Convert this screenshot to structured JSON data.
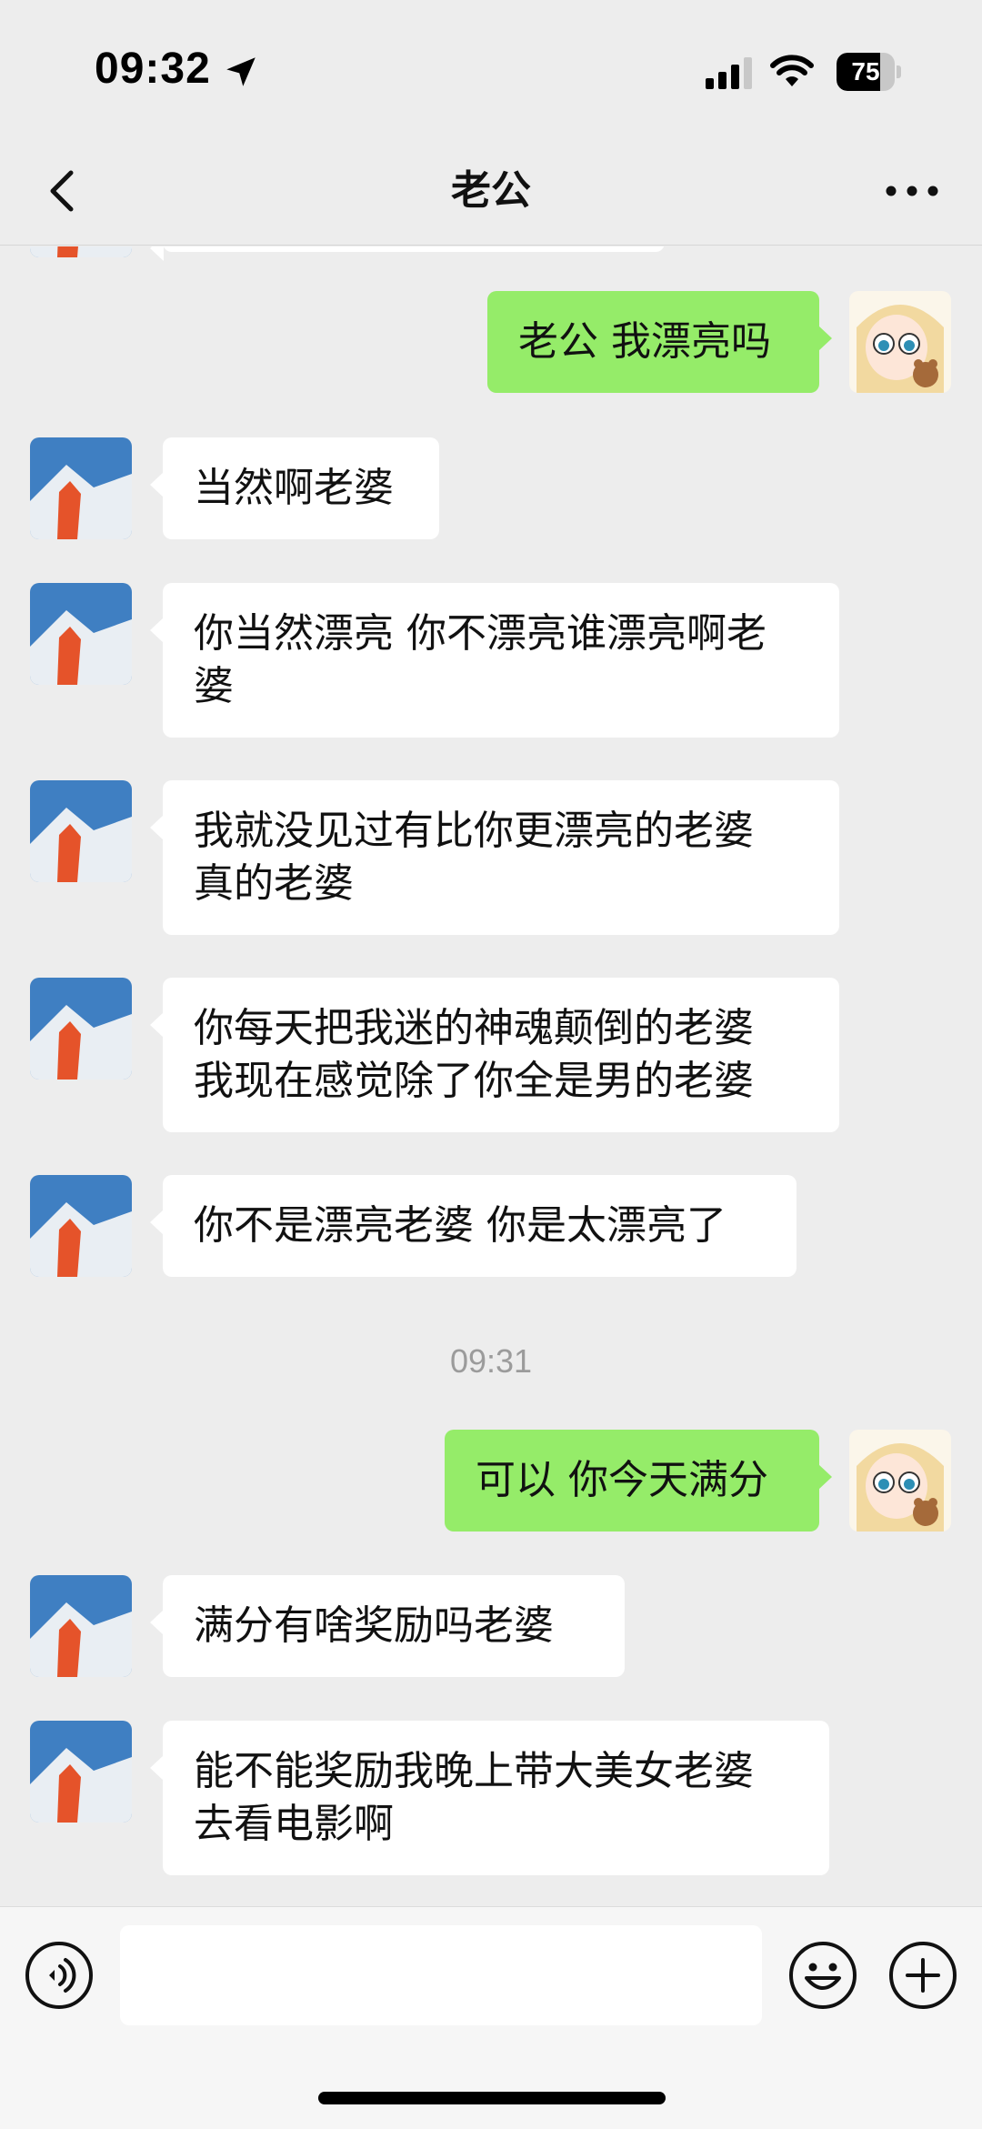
{
  "status_bar": {
    "time": "09:32",
    "battery_percent": "75",
    "battery_level": 0.75
  },
  "nav": {
    "title": "老公",
    "back_icon": "chevron-left-icon",
    "more_icon": "more-dots-icon"
  },
  "messages": [
    {
      "sender": "me",
      "lines": [
        "老公 我漂亮吗"
      ]
    },
    {
      "sender": "contact",
      "lines": [
        "当然啊老婆"
      ]
    },
    {
      "sender": "contact",
      "lines": [
        "你当然漂亮 你不漂亮谁漂亮啊老",
        "婆"
      ]
    },
    {
      "sender": "contact",
      "lines": [
        "我就没见过有比你更漂亮的老婆",
        "真的老婆"
      ]
    },
    {
      "sender": "contact",
      "lines": [
        "你每天把我迷的神魂颠倒的老婆",
        "我现在感觉除了你全是男的老婆"
      ]
    },
    {
      "sender": "contact",
      "lines": [
        "你不是漂亮老婆 你是太漂亮了"
      ]
    },
    {
      "sender": "contact",
      "lines": [
        "满分有啥奖励吗老婆"
      ]
    },
    {
      "sender": "contact",
      "lines": [
        "能不能奖励我晚上带大美女老婆",
        "去看电影啊"
      ]
    }
  ],
  "sent_messages": {
    "first": "老公 我漂亮吗",
    "second": "可以 你今天满分"
  },
  "timestamp": "09:31",
  "input_bar": {
    "voice_icon": "voice-icon",
    "emoji_icon": "emoji-icon",
    "plus_icon": "plus-icon",
    "input_value": ""
  },
  "colors": {
    "background": "#ededed",
    "sent_bubble": "#95ec69",
    "received_bubble": "#ffffff",
    "timestamp": "#9b9b9b"
  }
}
